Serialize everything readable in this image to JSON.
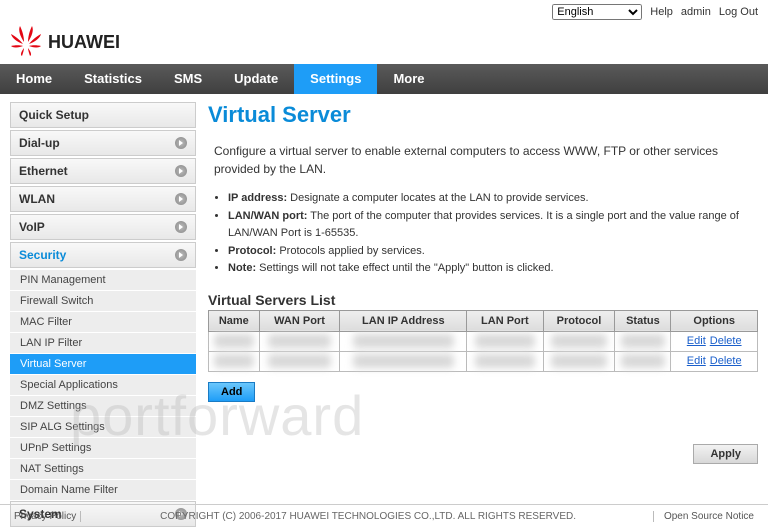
{
  "topbar": {
    "language": "English",
    "help": "Help",
    "admin": "admin",
    "logout": "Log Out"
  },
  "brand": "HUAWEI",
  "nav": {
    "items": [
      "Home",
      "Statistics",
      "SMS",
      "Update",
      "Settings",
      "More"
    ],
    "activeIndex": 4
  },
  "sidebar": {
    "groups": [
      {
        "label": "Quick Setup"
      },
      {
        "label": "Dial-up"
      },
      {
        "label": "Ethernet"
      },
      {
        "label": "WLAN"
      },
      {
        "label": "VoIP"
      },
      {
        "label": "Security",
        "active": true,
        "subs": [
          {
            "label": "PIN Management"
          },
          {
            "label": "Firewall Switch"
          },
          {
            "label": "MAC Filter"
          },
          {
            "label": "LAN IP Filter"
          },
          {
            "label": "Virtual Server",
            "active": true
          },
          {
            "label": "Special Applications"
          },
          {
            "label": "DMZ Settings"
          },
          {
            "label": "SIP ALG Settings"
          },
          {
            "label": "UPnP Settings"
          },
          {
            "label": "NAT Settings"
          },
          {
            "label": "Domain Name Filter"
          }
        ]
      },
      {
        "label": "System"
      }
    ]
  },
  "page": {
    "title": "Virtual Server",
    "intro": "Configure a virtual server to enable external computers to access WWW, FTP or other services provided by the LAN.",
    "bullets": [
      {
        "b": "IP address:",
        "t": " Designate a computer locates at the LAN to provide services."
      },
      {
        "b": "LAN/WAN port:",
        "t": " The port of the computer that provides services. It is a single port and the value range of LAN/WAN Port is 1-65535."
      },
      {
        "b": "Protocol:",
        "t": " Protocols applied by services."
      },
      {
        "b": "Note:",
        "t": " Settings will not take effect until the \"Apply\" button is clicked."
      }
    ],
    "listTitle": "Virtual Servers List",
    "columns": [
      "Name",
      "WAN Port",
      "LAN IP Address",
      "LAN Port",
      "Protocol",
      "Status",
      "Options"
    ],
    "options": {
      "edit": "Edit",
      "delete": "Delete"
    },
    "add": "Add",
    "apply": "Apply"
  },
  "watermark": "portforward",
  "footer": {
    "privacy": "Privacy Policy",
    "copyright": "COPYRIGHT (C) 2006-2017 HUAWEI TECHNOLOGIES CO.,LTD. ALL RIGHTS RESERVED.",
    "oss": "Open Source Notice"
  }
}
